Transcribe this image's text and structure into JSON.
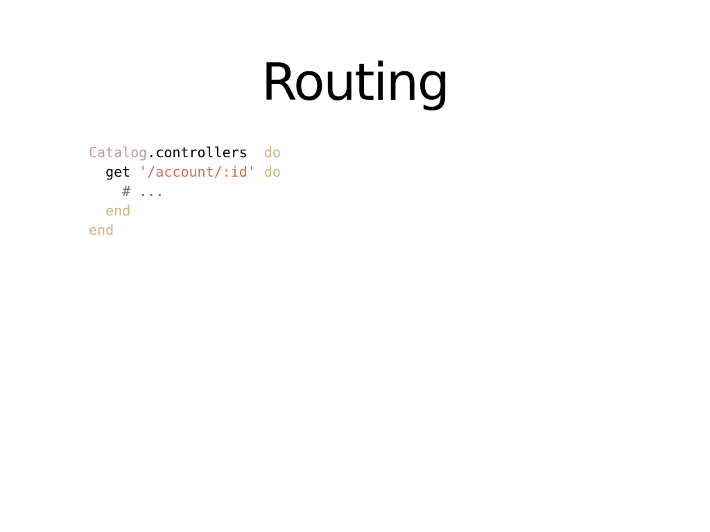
{
  "slide": {
    "title": "Routing"
  },
  "code": {
    "colors": {
      "constant": "#b79aac",
      "plain": "#000000",
      "keyword": "#d3b481",
      "string": "#dc6a52",
      "comment": "#6b6b6b"
    },
    "lines": [
      {
        "tokens": [
          {
            "text": "Catalog",
            "kind": "constant"
          },
          {
            "text": ".controllers  ",
            "kind": "plain"
          },
          {
            "text": "do",
            "kind": "keyword"
          }
        ]
      },
      {
        "tokens": [
          {
            "text": "  get ",
            "kind": "plain"
          },
          {
            "text": "'/account/:id'",
            "kind": "string"
          },
          {
            "text": " ",
            "kind": "plain"
          },
          {
            "text": "do",
            "kind": "keyword"
          }
        ]
      },
      {
        "tokens": [
          {
            "text": "    # ...",
            "kind": "comment"
          }
        ]
      },
      {
        "tokens": [
          {
            "text": "  ",
            "kind": "plain"
          },
          {
            "text": "end",
            "kind": "keyword"
          }
        ]
      },
      {
        "tokens": [
          {
            "text": "end",
            "kind": "keyword"
          }
        ]
      }
    ]
  }
}
